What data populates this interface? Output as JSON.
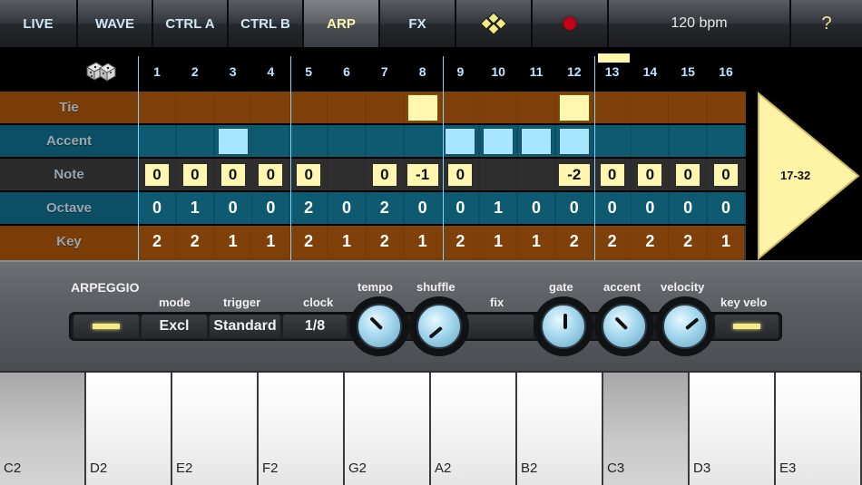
{
  "tabs": [
    {
      "label": "LIVE",
      "active": false
    },
    {
      "label": "WAVE",
      "active": false
    },
    {
      "label": "CTRL A",
      "active": false
    },
    {
      "label": "CTRL B",
      "active": false
    },
    {
      "label": "ARP",
      "active": true
    },
    {
      "label": "FX",
      "active": false
    }
  ],
  "topbar": {
    "logo_icon": "diamond-grid-icon",
    "record_icon": "record-dot-icon",
    "tempo_display": "120 bpm",
    "help_label": "?"
  },
  "sequencer": {
    "dice_icon": "dice-icon",
    "steps": [
      "1",
      "2",
      "3",
      "4",
      "5",
      "6",
      "7",
      "8",
      "9",
      "10",
      "11",
      "12",
      "13",
      "14",
      "15",
      "16"
    ],
    "current_step": 13,
    "rows": {
      "tie": {
        "label": "Tie",
        "values": [
          false,
          false,
          false,
          false,
          false,
          false,
          false,
          true,
          false,
          false,
          false,
          true,
          false,
          false,
          false,
          false
        ]
      },
      "accent": {
        "label": "Accent",
        "values": [
          false,
          false,
          true,
          false,
          false,
          false,
          false,
          false,
          true,
          true,
          true,
          true,
          false,
          false,
          false,
          false
        ]
      },
      "note": {
        "label": "Note",
        "values": [
          "0",
          "0",
          "0",
          "0",
          "0",
          "",
          "0",
          "-1",
          "0",
          "",
          "",
          "-2",
          "0",
          "0",
          "0",
          "0"
        ]
      },
      "octave": {
        "label": "Octave",
        "values": [
          "0",
          "1",
          "0",
          "0",
          "2",
          "0",
          "2",
          "0",
          "0",
          "1",
          "0",
          "0",
          "0",
          "0",
          "0",
          "0"
        ]
      },
      "key": {
        "label": "Key",
        "values": [
          "2",
          "2",
          "1",
          "1",
          "2",
          "1",
          "2",
          "1",
          "2",
          "1",
          "1",
          "2",
          "2",
          "2",
          "2",
          "1"
        ]
      }
    },
    "next_page_label": "17-32"
  },
  "arpeggio": {
    "title": "ARPEGGIO",
    "mode_label": "mode",
    "mode_value": "Excl",
    "trigger_label": "trigger",
    "trigger_value": "Standard",
    "clock_label": "clock",
    "clock_value": "1/8",
    "fix_label": "fix",
    "key_velo_label": "key velo",
    "knobs": [
      {
        "name": "tempo",
        "label": "tempo",
        "angle": -45
      },
      {
        "name": "shuffle",
        "label": "shuffle",
        "angle": -130
      },
      {
        "name": "gate",
        "label": "gate",
        "angle": 0
      },
      {
        "name": "accent",
        "label": "accent",
        "angle": -45
      },
      {
        "name": "velocity",
        "label": "velocity",
        "angle": 50
      }
    ]
  },
  "keyboard": {
    "keys": [
      {
        "name": "C2",
        "pressed": true
      },
      {
        "name": "D2",
        "pressed": false
      },
      {
        "name": "E2",
        "pressed": false
      },
      {
        "name": "F2",
        "pressed": false
      },
      {
        "name": "G2",
        "pressed": false
      },
      {
        "name": "A2",
        "pressed": false
      },
      {
        "name": "B2",
        "pressed": false
      },
      {
        "name": "C3",
        "pressed": true
      },
      {
        "name": "D3",
        "pressed": false
      },
      {
        "name": "E3",
        "pressed": false
      }
    ]
  }
}
